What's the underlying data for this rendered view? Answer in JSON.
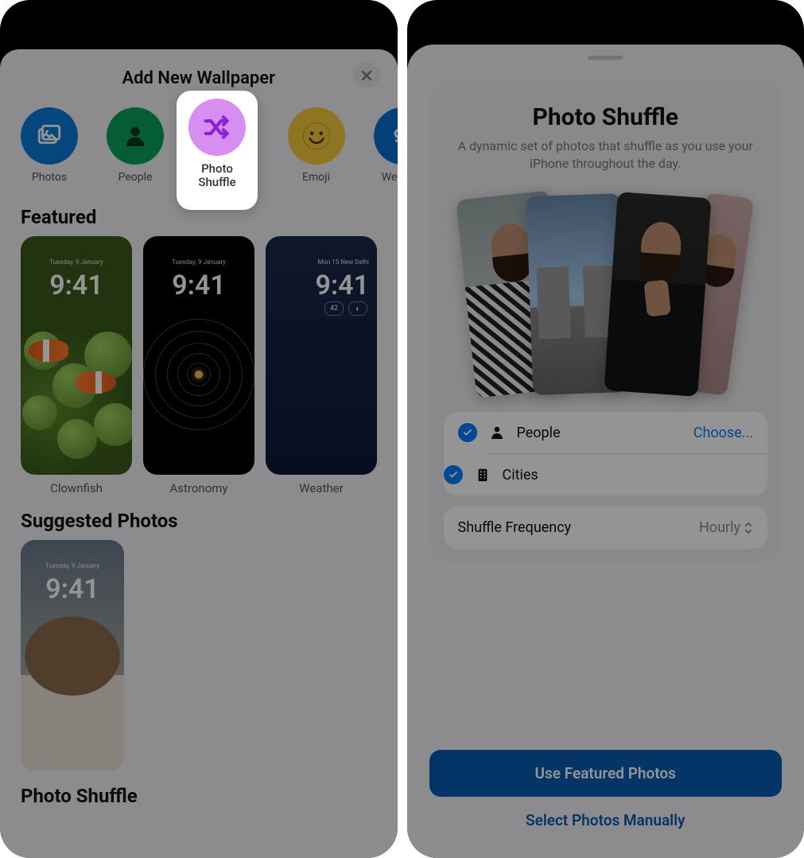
{
  "left": {
    "title": "Add New Wallpaper",
    "categories": {
      "photos": "Photos",
      "people": "People",
      "shuffle": "Photo Shuffle",
      "emoji": "Emoji",
      "weather": "Weather"
    },
    "highlighted_category": "Photo\nShuffle",
    "sections": {
      "featured": "Featured",
      "suggested": "Suggested Photos",
      "shuffle": "Photo Shuffle"
    },
    "featured_items": {
      "clownfish": {
        "label": "Clownfish",
        "time": "9:41",
        "date": "Tuesday, 9 January"
      },
      "astronomy": {
        "label": "Astronomy",
        "time": "9:41",
        "date": "Tuesday, 9 January"
      },
      "weather": {
        "label": "Weather",
        "time": "9:41",
        "date": "Mon 15  New Delhi",
        "badge1": "42",
        "badge2": "◐"
      }
    },
    "suggested": {
      "time": "9:41",
      "date": "Tuesday, 9 January"
    }
  },
  "right": {
    "modal_title": "Photo Shuffle",
    "modal_subtitle": "A dynamic set of photos that shuffle as you use your iPhone throughout the day.",
    "options": {
      "people": {
        "label": "People",
        "action": "Choose...",
        "checked": true
      },
      "cities": {
        "label": "Cities",
        "checked": true
      }
    },
    "frequency": {
      "label": "Shuffle Frequency",
      "value": "Hourly"
    },
    "buttons": {
      "primary": "Use Featured Photos",
      "secondary": "Select Photos Manually"
    }
  }
}
